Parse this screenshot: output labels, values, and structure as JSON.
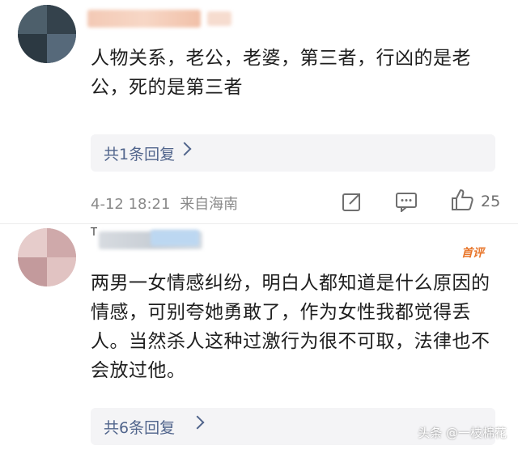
{
  "comments": [
    {
      "text": "人物关系，老公，老婆，第三者，行凶的是老公，死的是第三者",
      "reply_label": "共1条回复",
      "timestamp": "4-12 18:21",
      "location": "来自海南",
      "like_count": "25"
    },
    {
      "username_fragment": "T",
      "badge": "首评",
      "text": "两男一女情感纠纷，明白人都知道是什么原因的情感，可别夸她勇敢了，作为女性我都觉得丢人。当然杀人这种过激行为很不可取，法律也不会放过他。",
      "reply_label": "共6条回复"
    }
  ],
  "watermark": "头条 @一枝棉花",
  "icons": {
    "share": "share-icon",
    "comment": "comment-icon",
    "like": "thumbs-up-icon",
    "chevron": "chevron-right-icon"
  },
  "colors": {
    "reply_link": "#51658c",
    "badge": "#e8762b",
    "meta": "#8a8a8a"
  }
}
